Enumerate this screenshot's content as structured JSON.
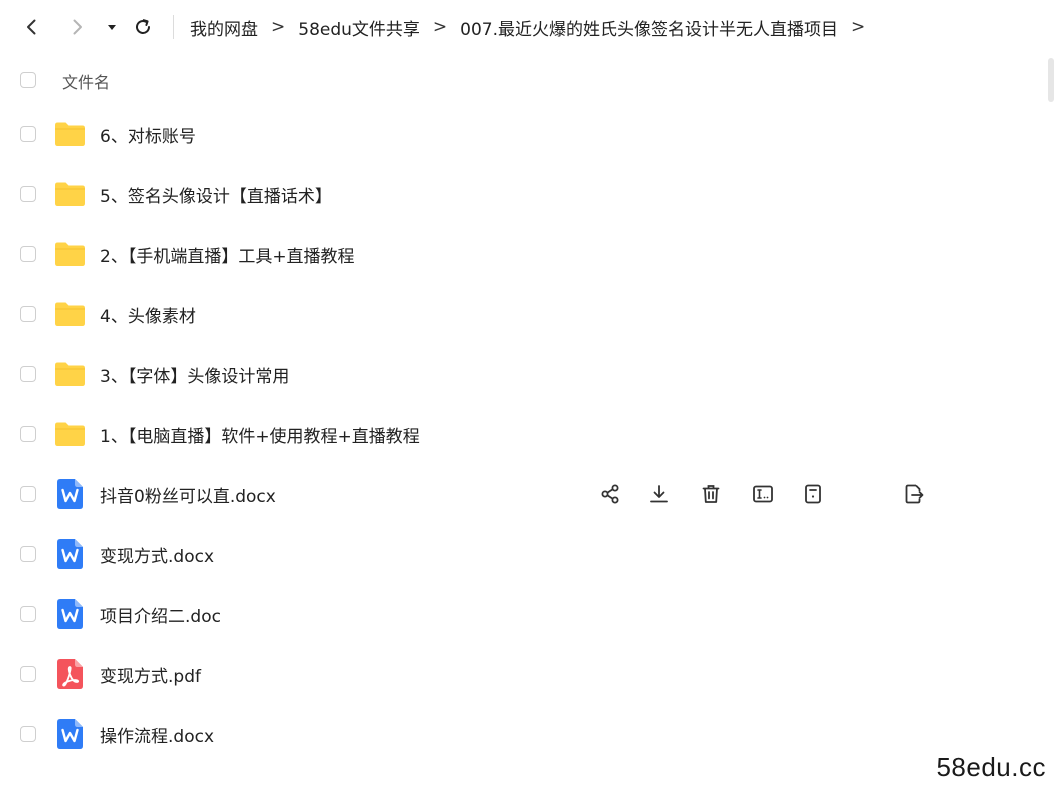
{
  "nav": {
    "back_icon": "chevron-left-icon",
    "forward_icon": "chevron-right-icon",
    "history_icon": "caret-down-icon",
    "refresh_icon": "refresh-icon"
  },
  "breadcrumb": [
    "我的网盘",
    "58edu文件共享",
    "007.最近火爆的姓氏头像签名设计半无人直播项目"
  ],
  "breadcrumb_separator": ">",
  "list_header": {
    "label": "文件名"
  },
  "files": [
    {
      "name": "6、对标账号",
      "type": "folder"
    },
    {
      "name": "5、签名头像设计【直播话术】",
      "type": "folder"
    },
    {
      "name": "2、【手机端直播】工具+直播教程",
      "type": "folder"
    },
    {
      "name": "4、头像素材",
      "type": "folder"
    },
    {
      "name": "3、【字体】头像设计常用",
      "type": "folder"
    },
    {
      "name": "1、【电脑直播】软件+使用教程+直播教程",
      "type": "folder"
    },
    {
      "name": "抖音0粉丝可以直.docx",
      "type": "word",
      "hovered": true
    },
    {
      "name": "变现方式.docx",
      "type": "word"
    },
    {
      "name": "项目介绍二.doc",
      "type": "word"
    },
    {
      "name": "变现方式.pdf",
      "type": "pdf"
    },
    {
      "name": "操作流程.docx",
      "type": "word"
    }
  ],
  "row_actions": [
    "share-icon",
    "download-icon",
    "delete-icon",
    "rename-icon",
    "details-icon",
    "move-copy-icon"
  ],
  "watermark": "58edu.cc",
  "colors": {
    "folder": "#FFD347",
    "word": "#2F7CF6",
    "pdf": "#F4545C",
    "icon_stroke": "#333333"
  }
}
